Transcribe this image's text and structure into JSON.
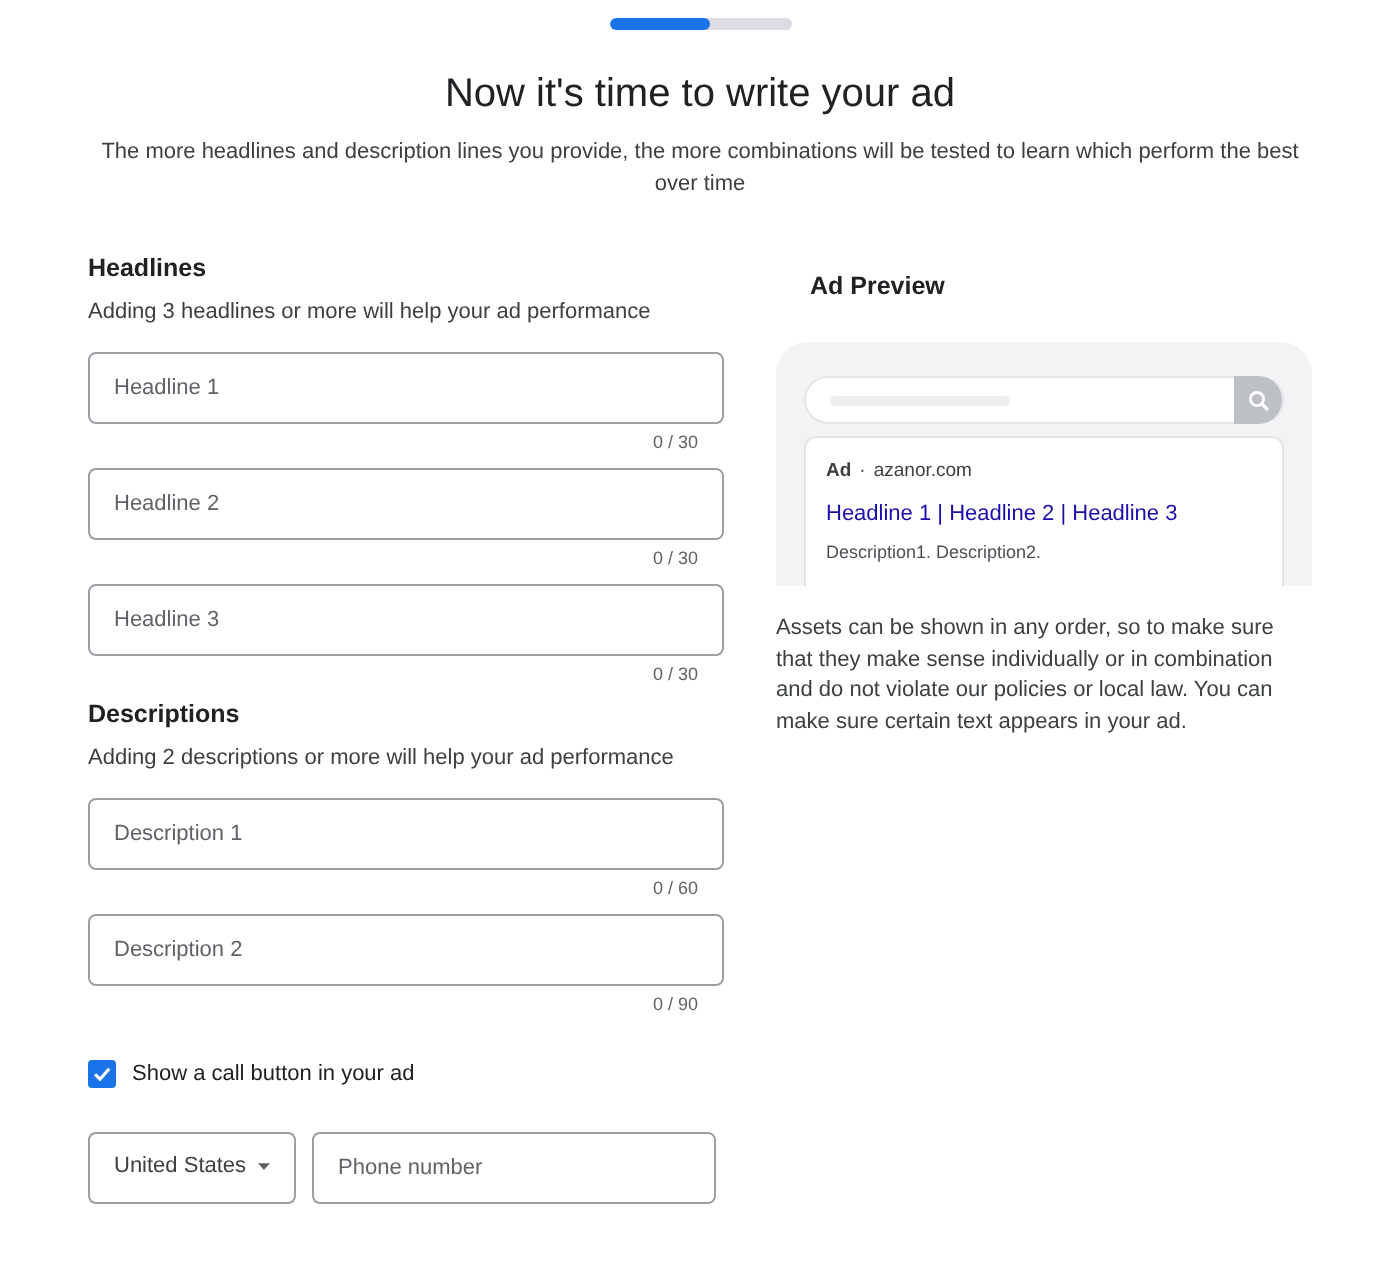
{
  "progress": {
    "level": 0.55
  },
  "title": "Now it's time to write your ad",
  "subtitle": "The more headlines and description lines you provide, the more combinations will be tested to learn which perform the best over time",
  "headlines": {
    "heading": "Headlines",
    "hint": "Adding 3 headlines or more will help your ad performance",
    "fields": [
      {
        "placeholder": "Headline 1",
        "counter": "0 / 30"
      },
      {
        "placeholder": "Headline 2",
        "counter": "0 / 30"
      },
      {
        "placeholder": "Headline 3",
        "counter": "0 / 30"
      }
    ]
  },
  "descriptions": {
    "heading": "Descriptions",
    "hint": "Adding 2 descriptions or more will help your ad performance",
    "fields": [
      {
        "placeholder": "Description 1",
        "counter": "0 / 60"
      },
      {
        "placeholder": "Description 2",
        "counter": "0 / 90"
      }
    ]
  },
  "call_button": {
    "label": "Show a call button in your ad",
    "checked": true
  },
  "country": {
    "value": "United States"
  },
  "phone": {
    "placeholder": "Phone number"
  },
  "preview": {
    "heading": "Ad Preview",
    "ad_label": "Ad",
    "separator": "·",
    "domain": "azanor.com",
    "headline": "Headline 1 | Headline 2 | Headline 3",
    "description": "Description1. Description2.",
    "note": "Assets can be shown in any order, so to make sure that they make sense individually or in combination and do not violate our policies or local law. You can make sure certain text appears in your ad."
  }
}
